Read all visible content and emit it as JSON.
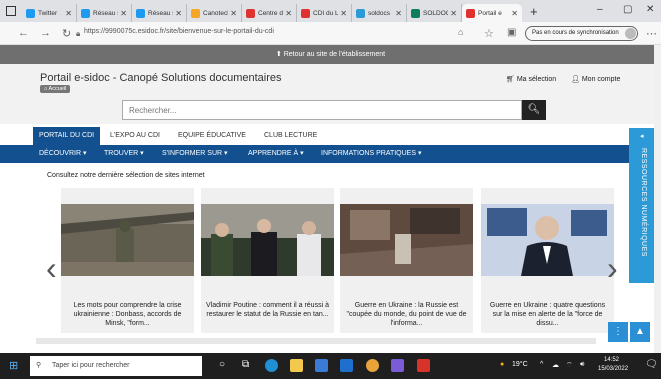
{
  "browser": {
    "tabs": [
      {
        "title": "Twitter",
        "fav_color": "#1d9bf0"
      },
      {
        "title": "Réseau s",
        "fav_color": "#1d9bf0"
      },
      {
        "title": "Réseau s",
        "fav_color": "#1d9bf0"
      },
      {
        "title": "Canotech",
        "fav_color": "#f5a623"
      },
      {
        "title": "Centre de",
        "fav_color": "#e03131"
      },
      {
        "title": "CDI du L",
        "fav_color": "#e03131"
      },
      {
        "title": "soldocs",
        "fav_color": "#2b9ad6"
      },
      {
        "title": "SOLDOC",
        "fav_color": "#0a7d5a"
      },
      {
        "title": "Portail e",
        "fav_color": "#e03131",
        "active": true
      }
    ],
    "new_tab": "+",
    "url": "https://9990075c.esidoc.fr/site/bienvenue-sur-le-portail-du-cdi",
    "sync_label": "Pas en cours de synchronisation"
  },
  "site": {
    "retour": "Retour au site de l'établissement",
    "title": "Portail e-sidoc - Canopé Solutions documentaires",
    "breadcrumb": "Accueil",
    "ma_selection": "Ma sélection",
    "mon_compte": "Mon compte",
    "search_placeholder": "Rechercher...",
    "tabs": [
      "PORTAIL DU CDI",
      "L'EXPO AU CDI",
      "EQUIPE ÉDUCATIVE",
      "CLUB LECTURE"
    ],
    "menu": [
      "DÉCOUVRIR ▾",
      "TROUVER ▾",
      "S'INFORMER SUR ▾",
      "APPRENDRE À ▾",
      "INFORMATIONS PRATIQUES ▾"
    ],
    "section_heading": "Consultez notre dernière sélection de sites internet",
    "cards": [
      {
        "caption": "Les mots pour comprendre la crise ukrainienne : Donbass, accords de Minsk, \"form..."
      },
      {
        "caption": "Vladimir Poutine : comment il a réussi à restaurer le statut de la Russie en tan..."
      },
      {
        "caption": "Guerre en Ukraine : la Russie est \"coupée du monde, du point de vue de l'informa..."
      },
      {
        "caption": "Guerre en Ukraine : quatre questions sur la mise en alerte de la \"force de dissu..."
      }
    ],
    "side_tab": "RESSOURCES NUMÉRIQUES"
  },
  "taskbar": {
    "search_placeholder": "Taper ici pour rechercher",
    "weather": "19°C",
    "time": "14:52",
    "date": "15/03/2022"
  }
}
